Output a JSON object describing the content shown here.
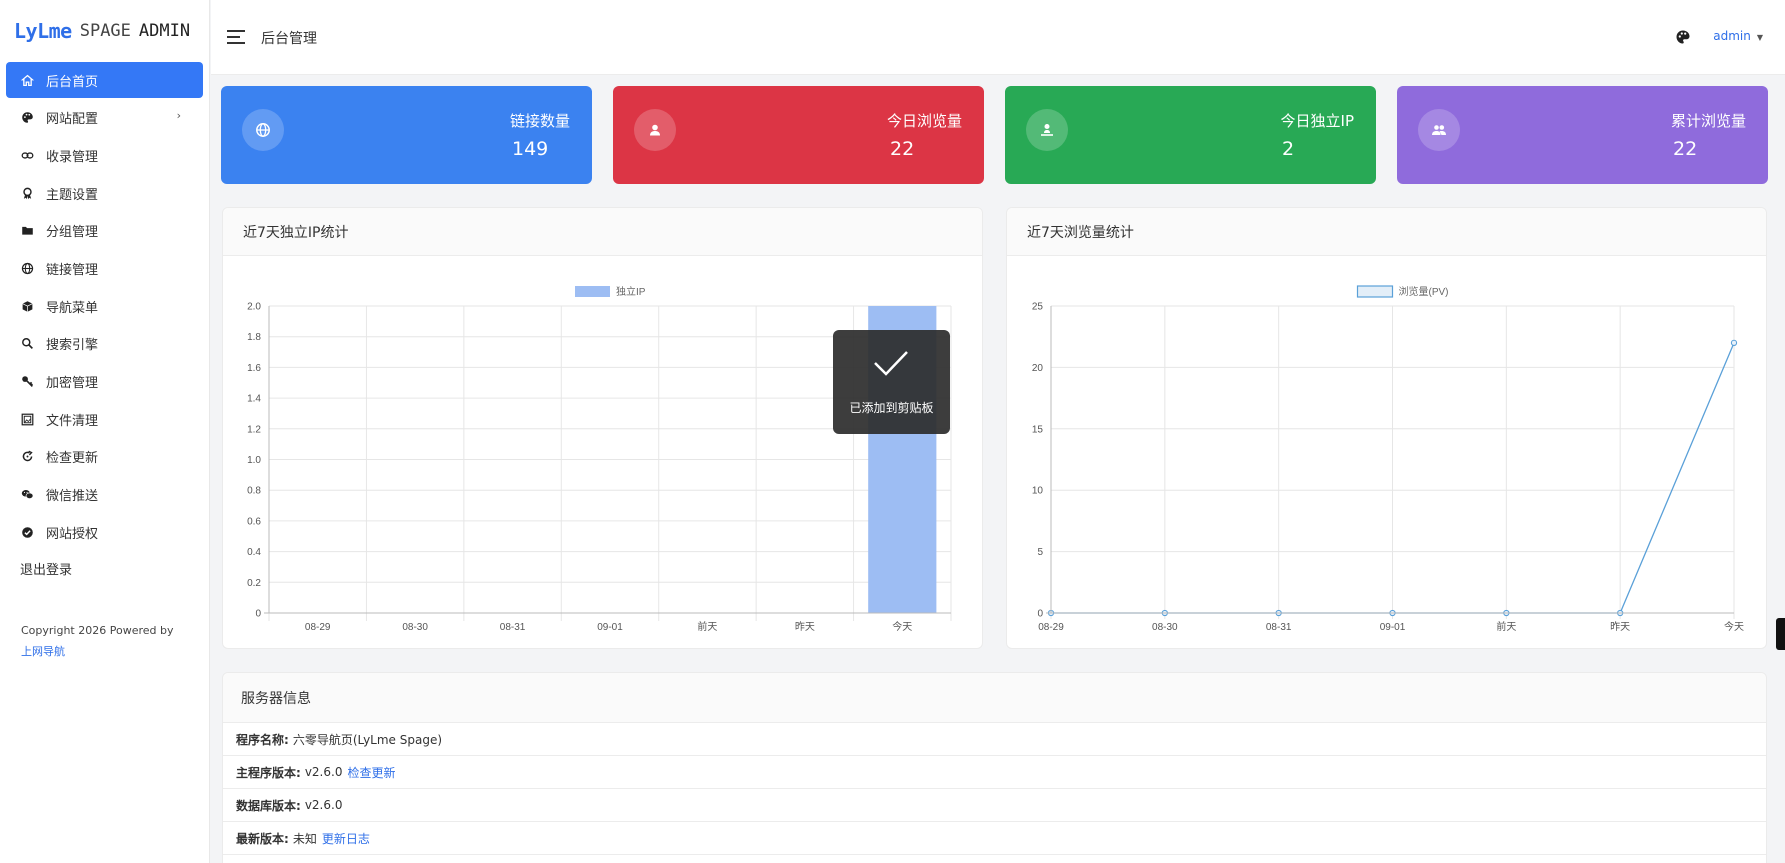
{
  "brand": {
    "part1": "LyLme",
    "part2": "SPAGE",
    "part3": "ADMIN"
  },
  "sidebar": {
    "items": [
      {
        "label": "后台首页",
        "icon": "home-icon",
        "active": true
      },
      {
        "label": "网站配置",
        "icon": "palette-icon",
        "has_submenu": true
      },
      {
        "label": "收录管理",
        "icon": "link-icon"
      },
      {
        "label": "主题设置",
        "icon": "award-icon"
      },
      {
        "label": "分组管理",
        "icon": "folder-icon"
      },
      {
        "label": "链接管理",
        "icon": "globe-icon"
      },
      {
        "label": "导航菜单",
        "icon": "cube-icon"
      },
      {
        "label": "搜索引擎",
        "icon": "search-icon"
      },
      {
        "label": "加密管理",
        "icon": "key-icon"
      },
      {
        "label": "文件清理",
        "icon": "images-icon"
      },
      {
        "label": "检查更新",
        "icon": "refresh-icon"
      },
      {
        "label": "微信推送",
        "icon": "wechat-icon"
      },
      {
        "label": "网站授权",
        "icon": "check-circle-icon"
      }
    ],
    "logout": "退出登录",
    "copyright": "Copyright 2026 Powered by",
    "copyright_link": "上网导航"
  },
  "topbar": {
    "title": "后台管理",
    "user": "admin"
  },
  "stats": [
    {
      "label": "链接数量",
      "value": "149",
      "color": "#3b82f0",
      "icon": "globe-icon"
    },
    {
      "label": "今日浏览量",
      "value": "22",
      "color": "#dc3545",
      "icon": "user-icon"
    },
    {
      "label": "今日独立IP",
      "value": "2",
      "color": "#28a955",
      "icon": "user-pin-icon"
    },
    {
      "label": "累计浏览量",
      "value": "22",
      "color": "#8f6bdc",
      "icon": "users-icon"
    }
  ],
  "ip_panel": {
    "title": "近7天独立IP统计"
  },
  "pv_panel": {
    "title": "近7天浏览量统计"
  },
  "toast": {
    "message": "已添加到剪贴板"
  },
  "chart_data": [
    {
      "type": "bar",
      "categories": [
        "08-29",
        "08-30",
        "08-31",
        "09-01",
        "前天",
        "昨天",
        "今天"
      ],
      "series": [
        {
          "name": "独立IP",
          "values": [
            0,
            0,
            0,
            0,
            0,
            0,
            2
          ],
          "color": "#9dbdf3"
        }
      ],
      "ylim": [
        0,
        2.0
      ],
      "yticks": [
        "0",
        "0.2",
        "0.4",
        "0.6",
        "0.8",
        "1.0",
        "1.2",
        "1.4",
        "1.6",
        "1.8",
        "2.0"
      ],
      "legend": "top-center",
      "grid": true
    },
    {
      "type": "line",
      "categories": [
        "08-29",
        "08-30",
        "08-31",
        "09-01",
        "前天",
        "昨天",
        "今天"
      ],
      "series": [
        {
          "name": "浏览量(PV)",
          "values": [
            0,
            0,
            0,
            0,
            0,
            0,
            22
          ],
          "color": "#5aa0d8"
        }
      ],
      "ylim": [
        0,
        25
      ],
      "yticks": [
        "0",
        "5",
        "10",
        "15",
        "20",
        "25"
      ],
      "legend": "top-center",
      "grid": true
    }
  ],
  "server": {
    "title": "服务器信息",
    "rows": [
      {
        "label": "程序名称:",
        "value": "六零导航页(LyLme Spage)",
        "link": ""
      },
      {
        "label": "主程序版本:",
        "value": "v2.6.0",
        "link": "检查更新"
      },
      {
        "label": "数据库版本:",
        "value": "v2.6.0",
        "link": ""
      },
      {
        "label": "最新版本:",
        "value": "未知",
        "link": "更新日志"
      }
    ]
  }
}
